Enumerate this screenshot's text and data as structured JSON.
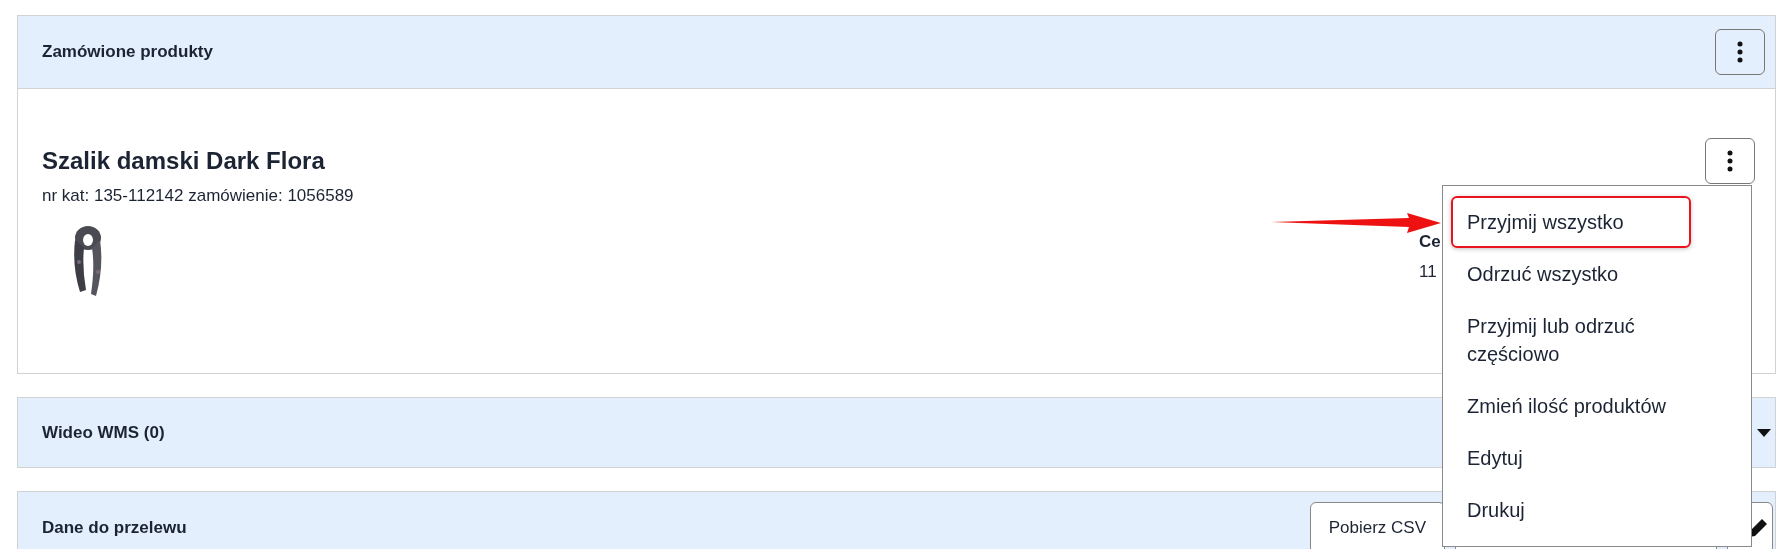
{
  "panels": [
    {
      "kind": "products",
      "title": "Zamówione produkty",
      "product": {
        "name": "Szalik damski Dark Flora",
        "meta": "nr kat: 135-112142 zamówienie: 1056589",
        "column_label": "Ce",
        "column_value": "11",
        "menu": [
          {
            "label": "Przyjmij wszystko",
            "highlighted": true
          },
          {
            "label": "Odrzuć wszystko",
            "highlighted": false
          },
          {
            "label": "Przyjmij lub odrzuć częściowo",
            "highlighted": false
          },
          {
            "label": "Zmień ilość produktów",
            "highlighted": false
          },
          {
            "label": "Edytuj",
            "highlighted": false
          },
          {
            "label": "Drukuj",
            "highlighted": false
          }
        ]
      }
    },
    {
      "kind": "collapsible",
      "title": "Wideo WMS (0)",
      "expanded": false
    },
    {
      "kind": "transfer",
      "title": "Dane do przelewu",
      "buttons": [
        "Pobierz CSV"
      ]
    }
  ]
}
